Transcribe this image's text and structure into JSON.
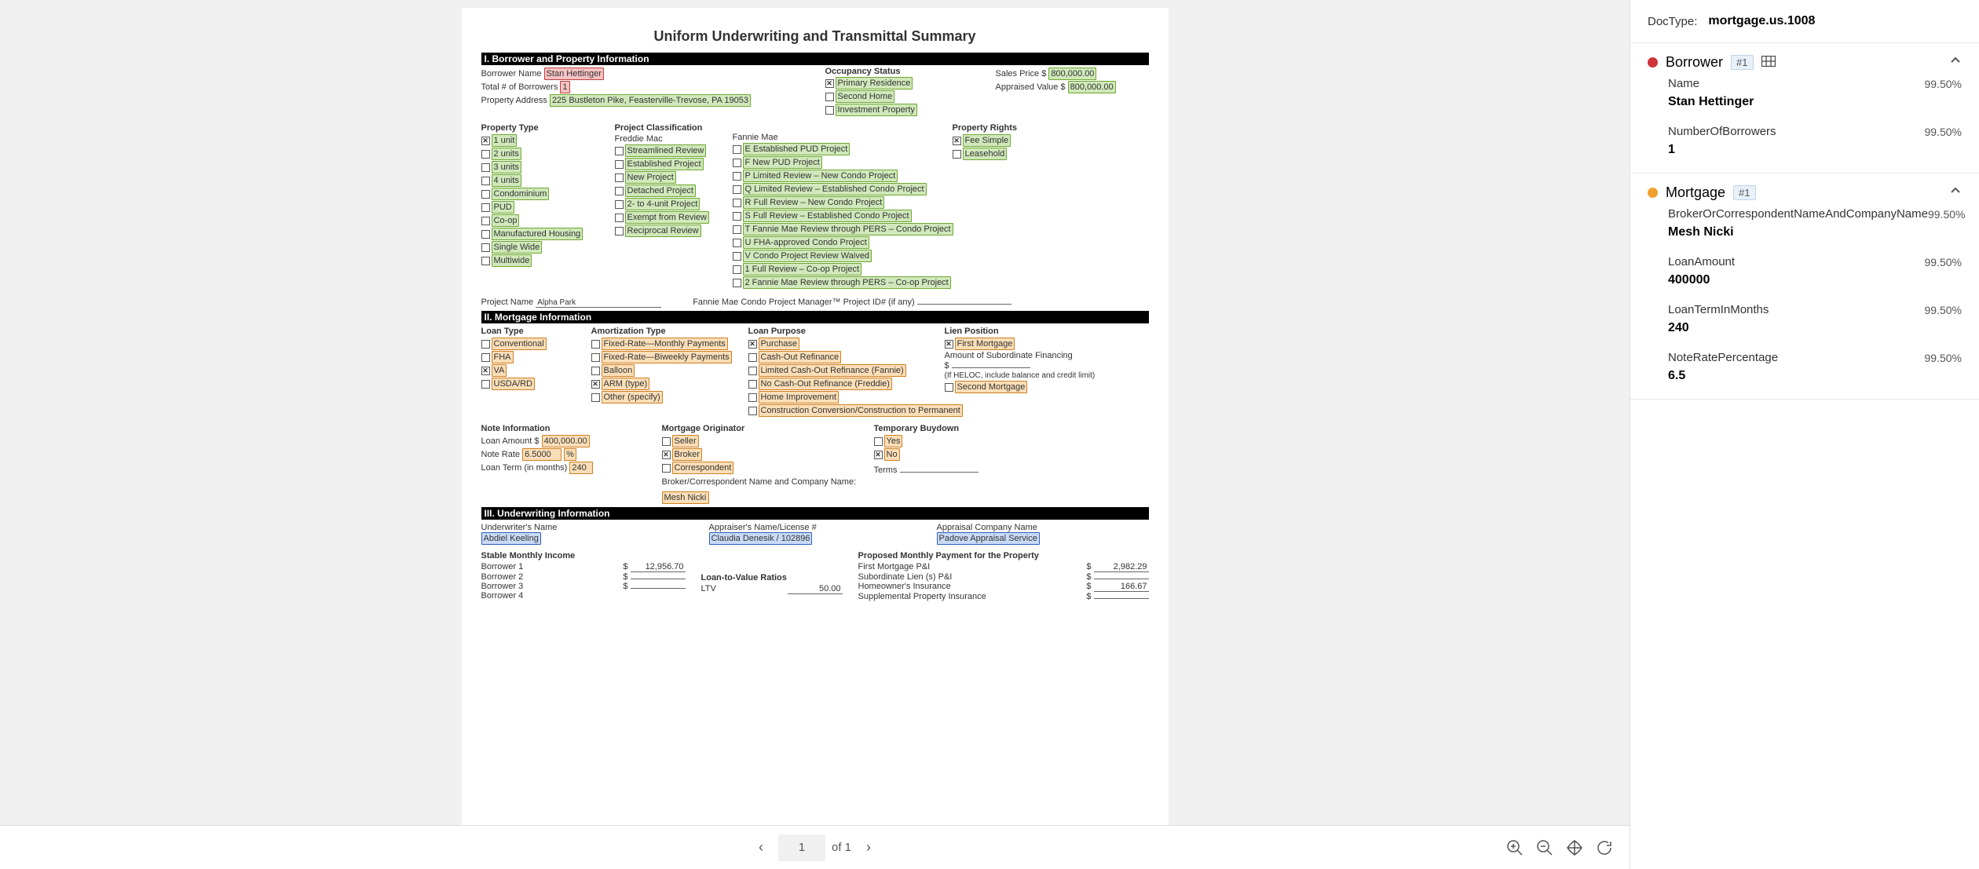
{
  "document": {
    "title": "Uniform Underwriting and Transmittal Summary",
    "section1": {
      "header": "I. Borrower and Property Information",
      "borrower_name_label": "Borrower Name",
      "borrower_name": "Stan Hettinger",
      "total_borrowers_label": "Total # of Borrowers",
      "total_borrowers": "1",
      "property_address_label": "Property Address",
      "property_address": "225 Bustleton Pike, Feasterville-Trevose, PA 19053",
      "occupancy_label": "Occupancy Status",
      "occupancy_items": [
        "Primary Residence",
        "Second Home",
        "Investment Property"
      ],
      "sales_price_label": "Sales Price $",
      "sales_price": "800,000.00",
      "appraised_label": "Appraised Value $",
      "appraised": "800,000.00",
      "property_type_label": "Property Type",
      "property_type_items": [
        "1 unit",
        "2 units",
        "3 units",
        "4 units",
        "Condominium",
        "PUD",
        "Co-op",
        "Manufactured Housing",
        "Single Wide",
        "Multiwide"
      ],
      "project_class_label": "Project Classification",
      "freddie_label": "Freddie Mac",
      "freddie_items": [
        "Streamlined Review",
        "Established Project",
        "New Project",
        "Detached Project",
        "2- to 4-unit Project",
        "Exempt from Review",
        "Reciprocal Review"
      ],
      "fannie_label": "Fannie Mae",
      "fannie_items": [
        "E Established PUD Project",
        "F New PUD Project",
        "P Limited Review – New Condo Project",
        "Q Limited Review – Established Condo Project",
        "R Full Review – New Condo Project",
        "S Full Review – Established Condo Project",
        "T Fannie Mae Review through PERS – Condo Project",
        "U FHA-approved Condo Project",
        "V Condo Project Review Waived",
        "1 Full Review – Co-op Project",
        "2 Fannie Mae Review through PERS – Co-op Project"
      ],
      "property_rights_label": "Property Rights",
      "property_rights_items": [
        "Fee Simple",
        "Leasehold"
      ],
      "project_name_label": "Project Name",
      "project_name": "Alpha Park",
      "condo_mgr_label": "Fannie Mae Condo Project Manager™ Project ID# (if any)"
    },
    "section2": {
      "header": "II. Mortgage Information",
      "loan_type_label": "Loan Type",
      "loan_type_items": [
        "Conventional",
        "FHA",
        "VA",
        "USDA/RD"
      ],
      "amort_label": "Amortization Type",
      "amort_items": [
        "Fixed-Rate—Monthly Payments",
        "Fixed-Rate—Biweekly Payments",
        "Balloon",
        "ARM (type)",
        "Other (specify)"
      ],
      "purpose_label": "Loan Purpose",
      "purpose_items": [
        "Purchase",
        "Cash-Out Refinance",
        "Limited Cash-Out Refinance (Fannie)",
        "No Cash-Out Refinance (Freddie)",
        "Home Improvement",
        "Construction Conversion/Construction to Permanent"
      ],
      "lien_label": "Lien Position",
      "first_mtg": "First Mortgage",
      "sub_fin": "Amount of Subordinate Financing",
      "sub_fin_dollar": "$",
      "heloc_note": "(If HELOC, include balance and credit limit)",
      "second_mtg": "Second Mortgage",
      "note_info_label": "Note Information",
      "loan_amt_label": "Loan Amount $",
      "loan_amt": "400,000.00",
      "note_rate_label": "Note Rate",
      "note_rate": "6.5000",
      "note_rate_pct": "%",
      "loan_term_label": "Loan Term (in months)",
      "loan_term": "240",
      "orig_label": "Mortgage Originator",
      "orig_items": [
        "Seller",
        "Broker",
        "Correspondent"
      ],
      "broker_name_label": "Broker/Correspondent Name and Company Name:",
      "broker_name": "Mesh Nicki",
      "buydown_label": "Temporary Buydown",
      "yes": "Yes",
      "no": "No",
      "terms_label": "Terms"
    },
    "section3": {
      "header": "III. Underwriting Information",
      "uw_label": "Underwriter's Name",
      "uw_name": "Abdiel Keeling",
      "appraiser_label": "Appraiser's Name/License #",
      "appraiser": "Claudia Denesik / 102896",
      "company_label": "Appraisal Company Name",
      "company": "Padove Appraisal Service",
      "income_label": "Stable Monthly Income",
      "b1": "Borrower 1",
      "b2": "Borrower 2",
      "b3": "Borrower 3",
      "b4": "Borrower 4",
      "b1_val": "12,956.70",
      "ltv_label": "Loan-to-Value Ratios",
      "ltv_item": "LTV",
      "ltv_val": "50.00",
      "proposed_label": "Proposed Monthly Payment for the Property",
      "first_pi": "First Mortgage P&I",
      "first_pi_val": "2,982.29",
      "sub_pi": "Subordinate Lien (s) P&I",
      "hoi": "Homeowner's Insurance",
      "hoi_val": "166.67",
      "supp": "Supplemental Property Insurance"
    }
  },
  "toolbar": {
    "page_current": "1",
    "page_of": "of 1"
  },
  "rpanel": {
    "doctype_label": "DocType:",
    "doctype_value": "mortgage.us.1008",
    "entities": [
      {
        "name": "Borrower",
        "badge": "#1",
        "color": "red",
        "show_grid": true,
        "fields": [
          {
            "name": "Name",
            "conf": "99.50%",
            "value": "Stan Hettinger"
          },
          {
            "name": "NumberOfBorrowers",
            "conf": "99.50%",
            "value": "1"
          }
        ]
      },
      {
        "name": "Mortgage",
        "badge": "#1",
        "color": "orange",
        "show_grid": false,
        "fields": [
          {
            "name": "BrokerOrCorrespondentNameAndCompanyName",
            "conf": "99.50%",
            "value": "Mesh Nicki"
          },
          {
            "name": "LoanAmount",
            "conf": "99.50%",
            "value": "400000"
          },
          {
            "name": "LoanTermInMonths",
            "conf": "99.50%",
            "value": "240"
          },
          {
            "name": "NoteRatePercentage",
            "conf": "99.50%",
            "value": "6.5"
          }
        ]
      }
    ]
  }
}
